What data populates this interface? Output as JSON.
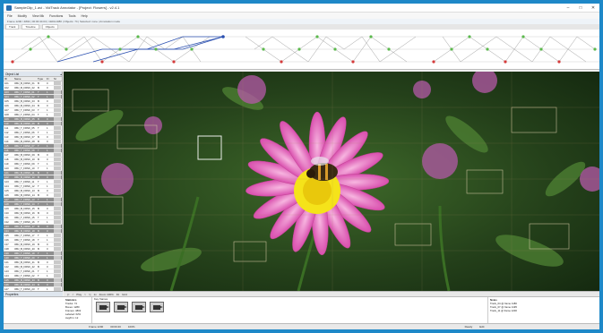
{
  "window": {
    "title": "SampleClip_1.avi - VidTrack Annotator - [Project: Flowers] - v2.4.1"
  },
  "menubar": [
    "File",
    "Modify",
    "View Mk",
    "Functions",
    "Tools",
    "Help"
  ],
  "infobar": "Frame 1200 / 4802  |  00:00:40.03  |  1920x1080  |  Objects: 74  |  Selected: none  |  Annotation mode",
  "tabs": [
    "Track",
    "Timeline",
    "Objects"
  ],
  "leftpanel": {
    "title": "Object List",
    "columns": [
      "ID",
      "Name",
      "Type",
      "Fr",
      "St"
    ],
    "rows": [
      [
        "101",
        "OBJ_B_FRNK_01",
        "B",
        "0",
        ""
      ],
      [
        "102",
        "OBJ_B_FRNK_02",
        "B",
        "0",
        ""
      ],
      [
        "103",
        "OBJ_T_FRNK_01",
        "T",
        "1",
        ""
      ],
      [
        "104",
        "OBJ_T_FRNK_02",
        "T",
        "1",
        ""
      ],
      [
        "105",
        "OBJ_B_FRNK_03",
        "B",
        "0",
        ""
      ],
      [
        "106",
        "OBJ_B_FRNK_04",
        "B",
        "0",
        ""
      ],
      [
        "107",
        "OBJ_T_FRNK_03",
        "T",
        "1",
        ""
      ],
      [
        "108",
        "OBJ_T_FRNK_04",
        "T",
        "1",
        ""
      ],
      [
        "109",
        "OBJ_B_FRNK_05",
        "B",
        "0",
        ""
      ],
      [
        "110",
        "OBJ_B_FRNK_06",
        "B",
        "0",
        ""
      ],
      [
        "111",
        "OBJ_T_FRNK_05",
        "T",
        "1",
        ""
      ],
      [
        "112",
        "OBJ_T_FRNK_06",
        "T",
        "1",
        ""
      ],
      [
        "113",
        "OBJ_B_FRNK_07",
        "B",
        "0",
        ""
      ],
      [
        "114",
        "OBJ_B_FRNK_08",
        "B",
        "0",
        ""
      ],
      [
        "115",
        "OBJ_T_FRNK_07",
        "T",
        "1",
        ""
      ],
      [
        "116",
        "OBJ_T_FRNK_08",
        "T",
        "1",
        ""
      ],
      [
        "117",
        "OBJ_B_FRNK_09",
        "B",
        "0",
        ""
      ],
      [
        "118",
        "OBJ_B_FRNK_10",
        "B",
        "0",
        ""
      ],
      [
        "119",
        "OBJ_T_FRNK_09",
        "T",
        "1",
        ""
      ],
      [
        "120",
        "OBJ_T_FRNK_10",
        "T",
        "1",
        ""
      ],
      [
        "121",
        "OBJ_B_FRNK_11",
        "B",
        "0",
        ""
      ],
      [
        "122",
        "OBJ_B_FRNK_12",
        "B",
        "0",
        ""
      ],
      [
        "123",
        "OBJ_T_FRNK_11",
        "T",
        "1",
        ""
      ],
      [
        "124",
        "OBJ_T_FRNK_12",
        "T",
        "1",
        ""
      ],
      [
        "125",
        "OBJ_B_FRNK_13",
        "B",
        "0",
        ""
      ],
      [
        "126",
        "OBJ_B_FRNK_14",
        "B",
        "0",
        ""
      ],
      [
        "127",
        "OBJ_T_FRNK_13",
        "T",
        "1",
        ""
      ],
      [
        "128",
        "OBJ_T_FRNK_14",
        "T",
        "1",
        ""
      ],
      [
        "129",
        "OBJ_B_FRNK_15",
        "B",
        "0",
        ""
      ],
      [
        "130",
        "OBJ_B_FRNK_16",
        "B",
        "0",
        ""
      ],
      [
        "131",
        "OBJ_T_FRNK_15",
        "T",
        "1",
        ""
      ],
      [
        "132",
        "OBJ_T_FRNK_16",
        "T",
        "1",
        ""
      ],
      [
        "133",
        "OBJ_B_FRNK_17",
        "B",
        "0",
        ""
      ],
      [
        "134",
        "OBJ_B_FRNK_18",
        "B",
        "0",
        ""
      ],
      [
        "135",
        "OBJ_T_FRNK_17",
        "T",
        "1",
        ""
      ],
      [
        "136",
        "OBJ_T_FRNK_18",
        "T",
        "1",
        ""
      ],
      [
        "137",
        "OBJ_B_FRNK_19",
        "B",
        "0",
        ""
      ],
      [
        "138",
        "OBJ_B_FRNK_20",
        "B",
        "0",
        ""
      ],
      [
        "139",
        "OBJ_T_FRNK_19",
        "T",
        "1",
        ""
      ],
      [
        "140",
        "OBJ_T_FRNK_20",
        "T",
        "1",
        ""
      ],
      [
        "141",
        "OBJ_B_FRNK_21",
        "B",
        "0",
        ""
      ],
      [
        "142",
        "OBJ_B_FRNK_22",
        "B",
        "0",
        ""
      ],
      [
        "143",
        "OBJ_T_FRNK_21",
        "T",
        "1",
        ""
      ],
      [
        "144",
        "OBJ_T_FRNK_22",
        "T",
        "1",
        ""
      ],
      [
        "145",
        "OBJ_B_FRNK_23",
        "B",
        "0",
        ""
      ],
      [
        "146",
        "OBJ_B_FRNK_24",
        "B",
        "0",
        ""
      ],
      [
        "147",
        "OBJ_T_FRNK_23",
        "T",
        "1",
        ""
      ]
    ]
  },
  "bottomleft": {
    "title": "Properties",
    "lines": [
      "X: 1024",
      "Y: 512",
      "W: 220",
      "H: 180",
      "Score: 0.96",
      "Class: Bee"
    ]
  },
  "toolbar2": [
    "|<",
    "<",
    "Play",
    ">",
    ">|",
    "1x",
    "Zoom 100%",
    "Fit",
    "Grid"
  ],
  "bottompanel": {
    "left_title": "Statistics",
    "mid_title": "Key frames",
    "right_title": "Notes",
    "stats": [
      "Tracks: 74",
      "Boxes: 1280",
      "Frames: 4802",
      "Labeled: 62%",
      "Avg/frm: 12"
    ],
    "notes": [
      "Track_04 @ frame 1180",
      "Track_07 @ frame 1195",
      "Track_11 @ frame 1200"
    ]
  },
  "statusbar": [
    "Frame 1200",
    "00:00:40",
    "100%",
    "Ready",
    "Edit"
  ]
}
